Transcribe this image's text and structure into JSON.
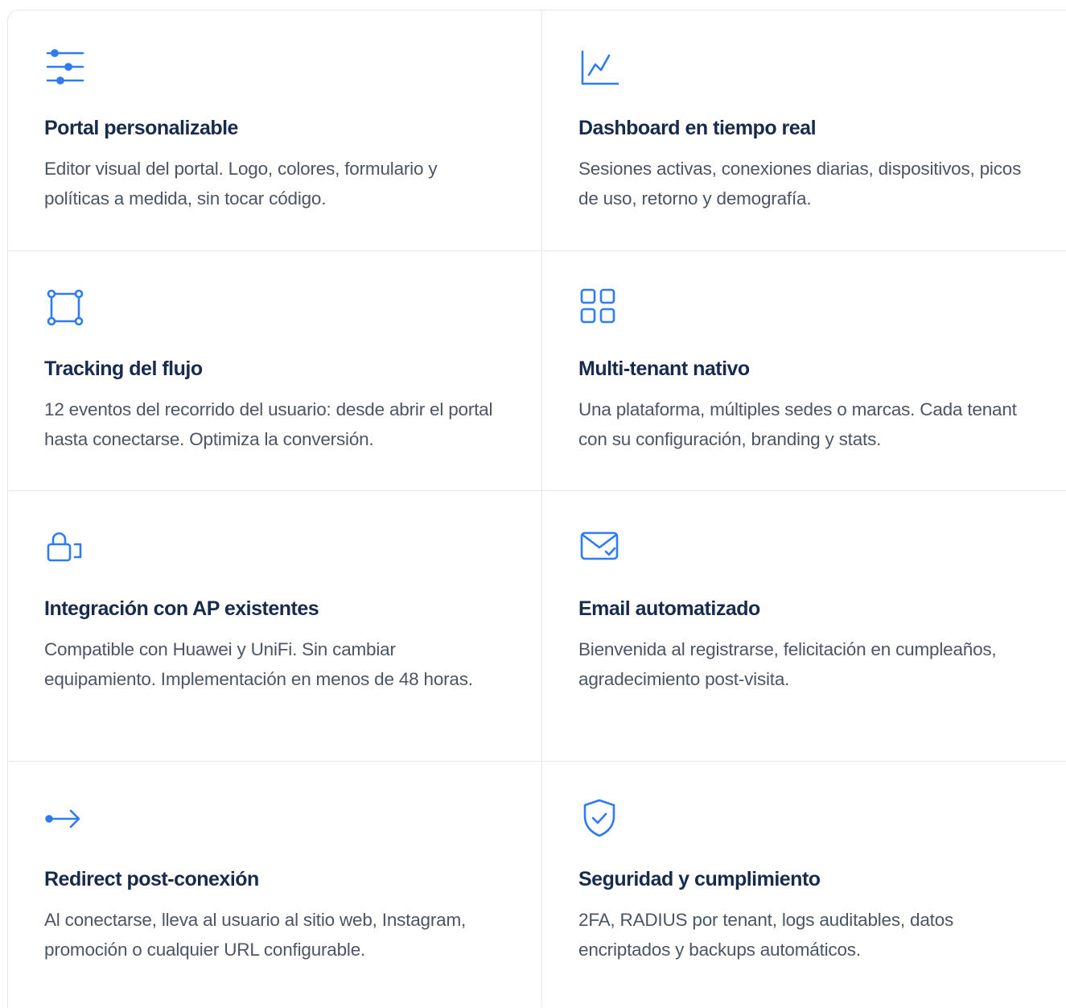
{
  "theme": {
    "icon_color": "#2f7bf5",
    "title_color": "#172b4d",
    "text_color": "#4b5563",
    "border_color": "#e5e7eb"
  },
  "features": [
    {
      "icon": "sliders-icon",
      "title": "Portal personalizable",
      "description": "Editor visual del portal. Logo, colores, formulario y políticas a medida, sin tocar código."
    },
    {
      "icon": "line-chart-icon",
      "title": "Dashboard en tiempo real",
      "description": "Sesiones activas, conexiones diarias, dispositivos, picos de uso, retorno y demografía."
    },
    {
      "icon": "flow-nodes-icon",
      "title": "Tracking del flujo",
      "description": "12 eventos del recorrido del usuario: desde abrir el portal hasta conectarse. Optimiza la conversión."
    },
    {
      "icon": "grid-icon",
      "title": "Multi-tenant nativo",
      "description": "Una plataforma, múltiples sedes o marcas. Cada tenant con su configuración, branding y stats."
    },
    {
      "icon": "lock-plug-icon",
      "title": "Integración con AP existentes",
      "description": "Compatible con Huawei y UniFi. Sin cambiar equipamiento. Implementación en menos de 48 horas."
    },
    {
      "icon": "mail-check-icon",
      "title": "Email automatizado",
      "description": "Bienvenida al registrarse, felicitación en cumpleaños, agradecimiento post-visita."
    },
    {
      "icon": "redirect-arrow-icon",
      "title": "Redirect post-conexión",
      "description": "Al conectarse, lleva al usuario al sitio web, Instagram, promoción o cualquier URL configurable."
    },
    {
      "icon": "shield-check-icon",
      "title": "Seguridad y cumplimiento",
      "description": "2FA, RADIUS por tenant, logs auditables, datos encriptados y backups automáticos."
    }
  ]
}
